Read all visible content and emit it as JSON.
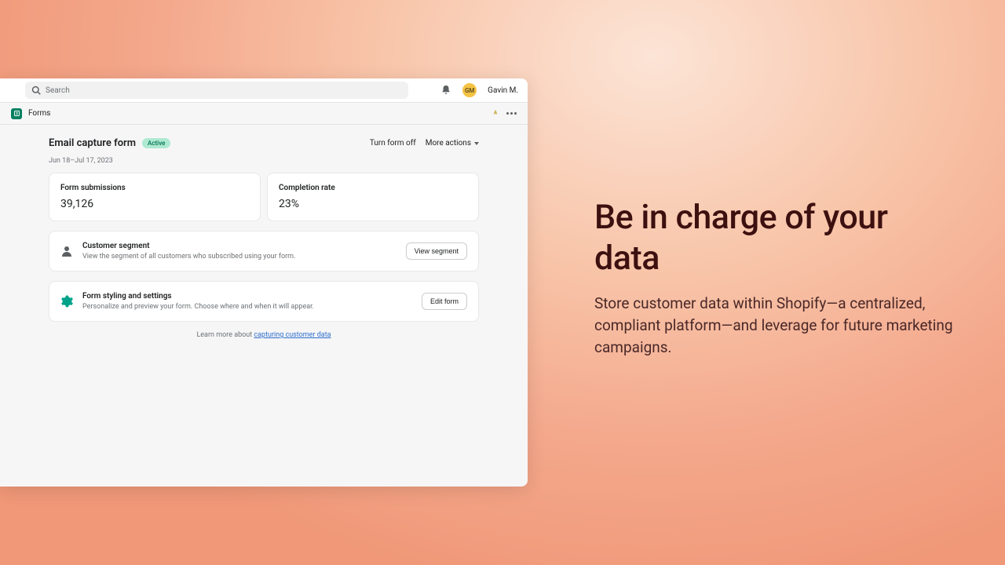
{
  "topbar": {
    "search_placeholder": "Search",
    "user_initials": "GM",
    "user_name": "Gavin M."
  },
  "subbar": {
    "title": "Forms"
  },
  "page": {
    "title": "Email capture form",
    "badge": "Active",
    "turn_off": "Turn form off",
    "more_actions": "More actions",
    "date_range": "Jun 18–Jul 17, 2023"
  },
  "stats": [
    {
      "label": "Form submissions",
      "value": "39,126"
    },
    {
      "label": "Completion rate",
      "value": "23%"
    }
  ],
  "cards": [
    {
      "title": "Customer segment",
      "desc": "View the segment of all customers who subscribed using your form.",
      "button": "View segment"
    },
    {
      "title": "Form styling and settings",
      "desc": "Personalize and preview your form. Choose where and when it will appear.",
      "button": "Edit form"
    }
  ],
  "learn": {
    "prefix": "Learn more about ",
    "link": "capturing customer data"
  },
  "marketing": {
    "heading": "Be in charge of your data",
    "body": "Store customer data within Shopify—a centralized, compliant platform—and leverage for future marketing campaigns."
  }
}
